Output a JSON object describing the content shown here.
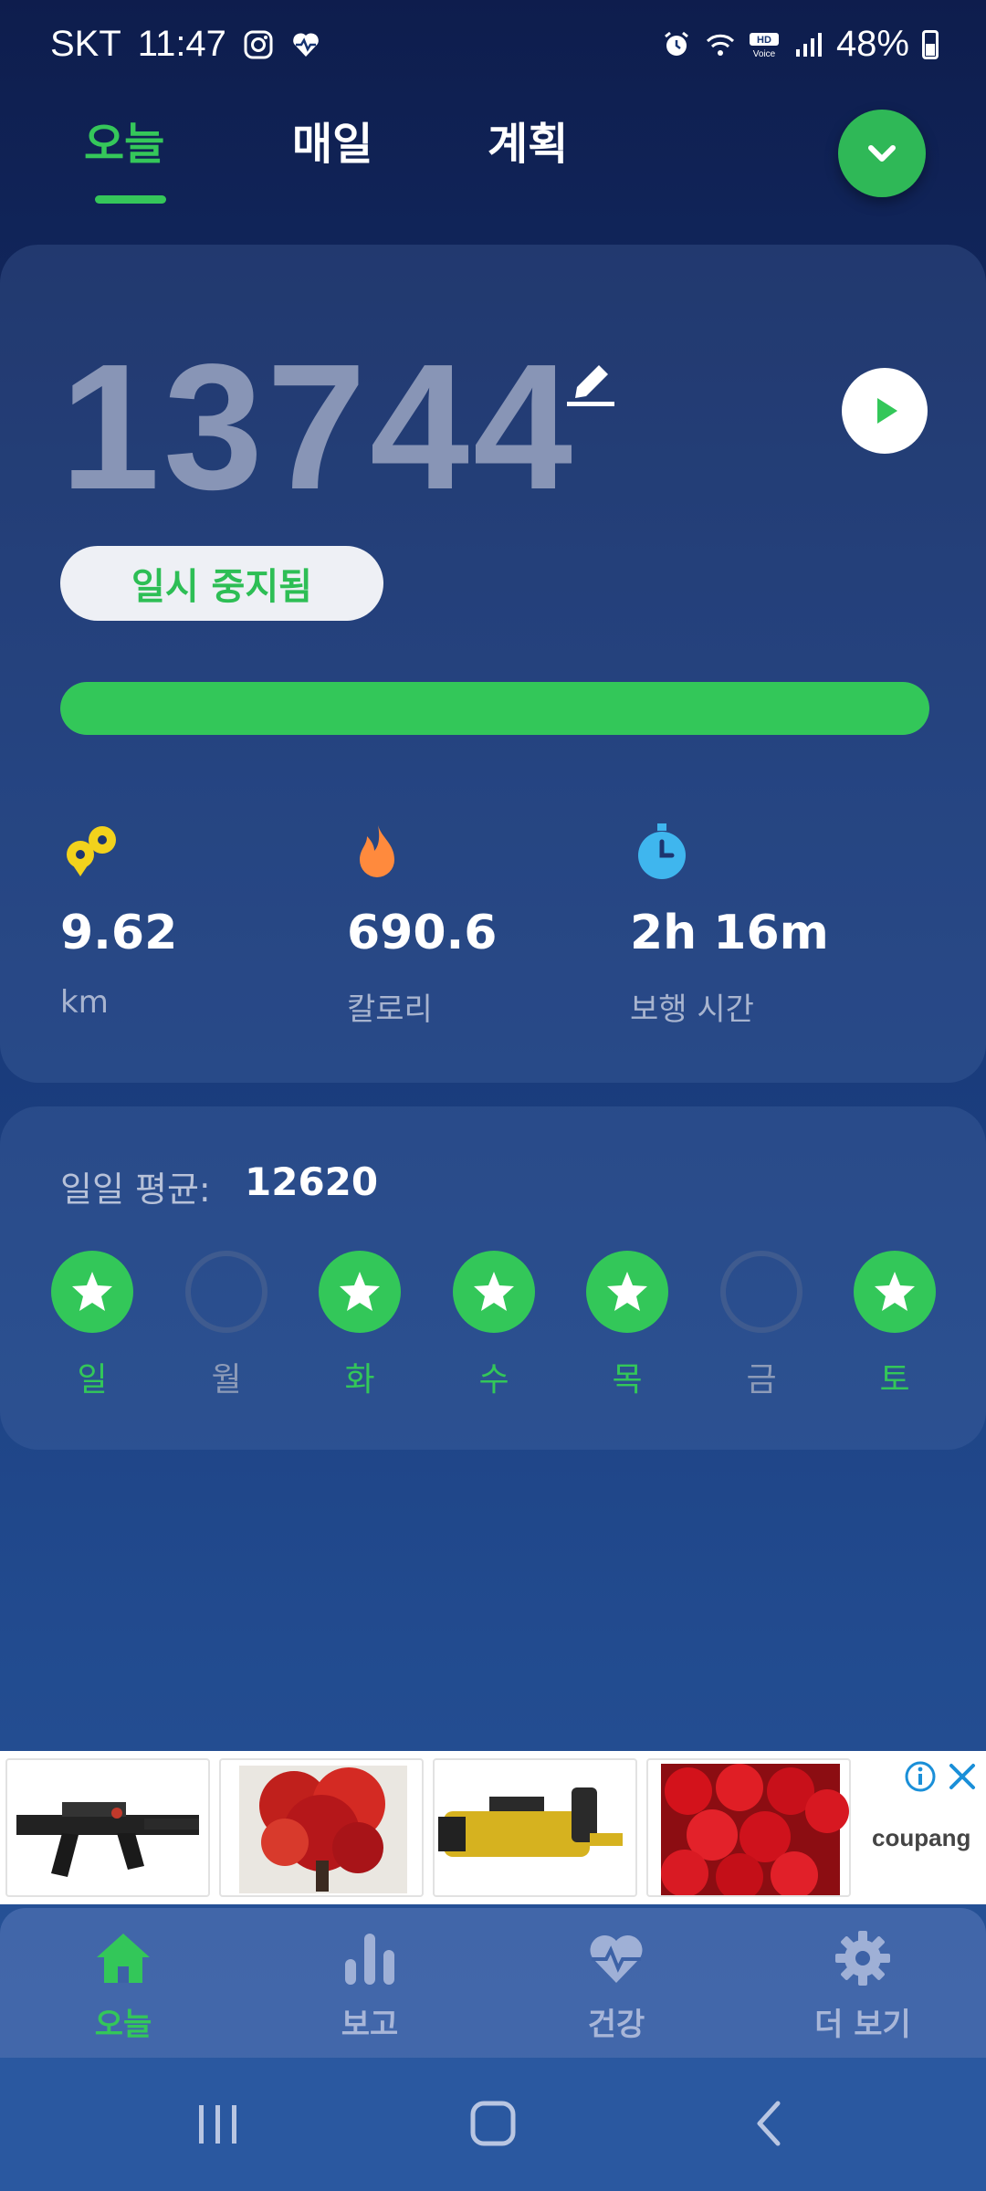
{
  "status_bar": {
    "carrier": "SKT",
    "time": "11:47",
    "battery": "48%",
    "icons": [
      "instagram-icon",
      "health-icon",
      "alarm-icon",
      "wifi-icon",
      "hd-voice-icon",
      "signal-icon",
      "battery-icon"
    ]
  },
  "tabs": [
    {
      "label": "오늘",
      "active": true
    },
    {
      "label": "매일",
      "active": false
    },
    {
      "label": "계획",
      "active": false
    }
  ],
  "today": {
    "steps": "13744",
    "status": "일시 중지됨",
    "progress": 1.0,
    "stats": [
      {
        "value": "9.62",
        "label": "km",
        "icon": "distance-icon",
        "color": "#f2d21c"
      },
      {
        "value": "690.6",
        "label": "칼로리",
        "icon": "flame-icon",
        "color": "#ff8a3d"
      },
      {
        "value": "2h 16m",
        "label": "보행 시간",
        "icon": "stopwatch-icon",
        "color": "#3fb6ee"
      }
    ]
  },
  "weekly": {
    "avg_label": "일일 평균:",
    "avg_value": "12620",
    "days": [
      {
        "label": "일",
        "achieved": true
      },
      {
        "label": "월",
        "achieved": false
      },
      {
        "label": "화",
        "achieved": true
      },
      {
        "label": "수",
        "achieved": true
      },
      {
        "label": "목",
        "achieved": true
      },
      {
        "label": "금",
        "achieved": false
      },
      {
        "label": "토",
        "achieved": true
      }
    ]
  },
  "ad": {
    "brand": "coupang",
    "images": [
      "rifle-toy-image",
      "red-flower-painting-image",
      "gatling-toy-image",
      "red-apples-image"
    ]
  },
  "bottom_nav": [
    {
      "label": "오늘",
      "icon": "home-icon",
      "active": true
    },
    {
      "label": "보고",
      "icon": "bar-chart-icon",
      "active": false
    },
    {
      "label": "건강",
      "icon": "heart-pulse-icon",
      "active": false
    },
    {
      "label": "더 보기",
      "icon": "gear-icon",
      "active": false
    }
  ],
  "colors": {
    "accent": "#33c759",
    "background_top": "#0e1d4d",
    "background_bottom": "#28569b"
  }
}
